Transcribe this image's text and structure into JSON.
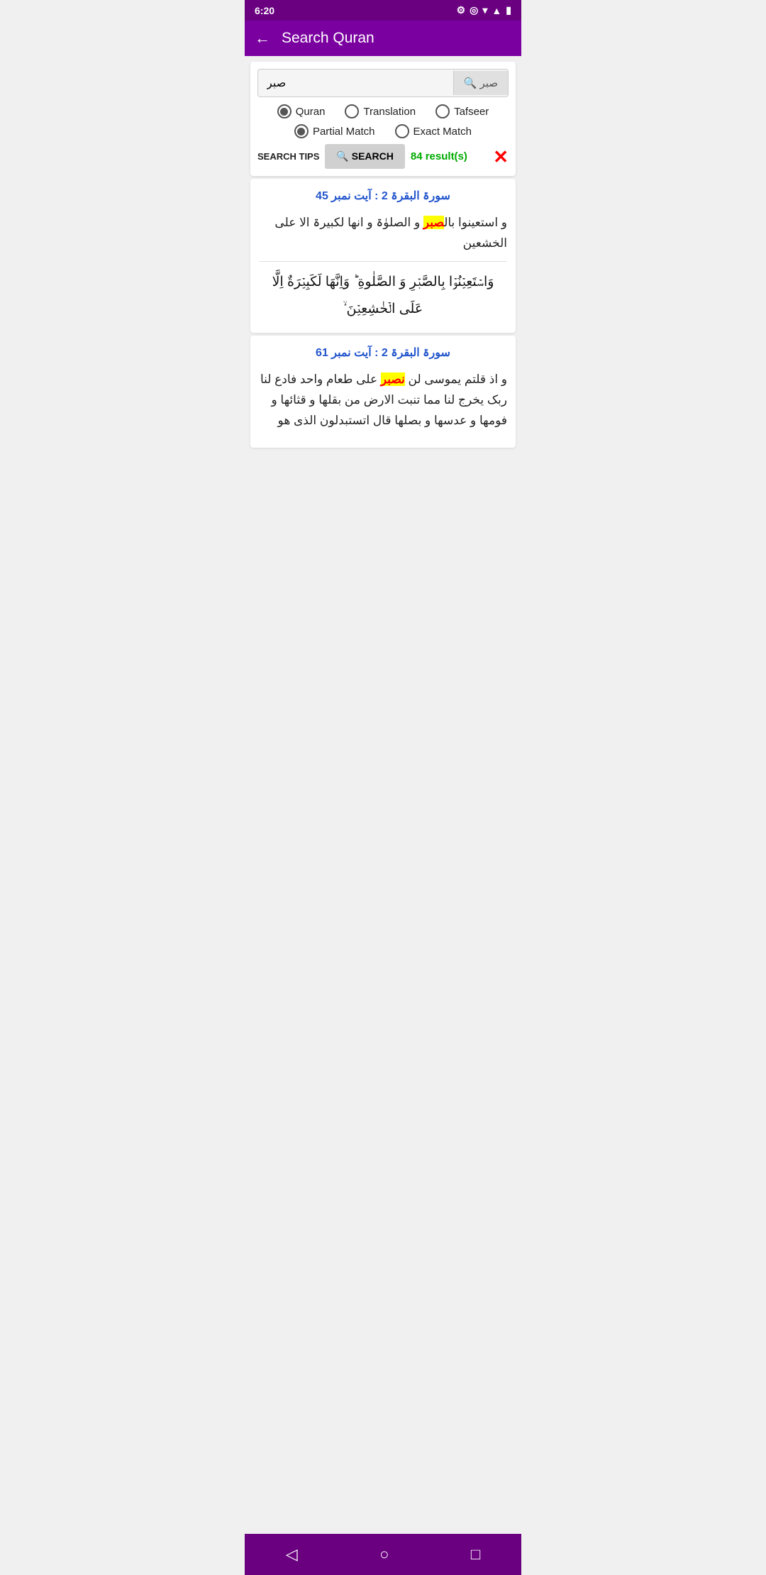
{
  "statusBar": {
    "time": "6:20",
    "icons": [
      "settings",
      "circle-badge",
      "wifi",
      "signal",
      "battery"
    ]
  },
  "topBar": {
    "title": "Search Quran",
    "backLabel": "←"
  },
  "searchInput": {
    "value": "صبر",
    "placeholder": ""
  },
  "radioGroups": {
    "source": [
      {
        "id": "quran",
        "label": "Quran",
        "selected": true
      },
      {
        "id": "translation",
        "label": "Translation",
        "selected": false
      },
      {
        "id": "tafseer",
        "label": "Tafseer",
        "selected": false
      }
    ],
    "matchType": [
      {
        "id": "partial",
        "label": "Partial Match",
        "selected": true
      },
      {
        "id": "exact",
        "label": "Exact Match",
        "selected": false
      }
    ]
  },
  "actions": {
    "searchTipsLabel": "SEARCH TIPS",
    "searchBtnLabel": "🔍 SEARCH",
    "resultCount": "84 result(s)",
    "clearLabel": "✕"
  },
  "results": [
    {
      "header": "سورۃ البقرۃ 2 : آیت نمبر 45",
      "translation": "و استعینوا بالصبر و الصلوٰۃ و انھا لکبیرۃ الا علی الخشعین",
      "highlightWord": "صبر",
      "arabic": "وَاسۡتَعِيۡنُوۡا بِالصَّبۡرِ وَ الصَّلٰوةِ ؕ وَاِنَّهَا لَكَبِيۡرَةٌ اِلَّا عَلَى الۡخٰشِعِيۡنَ ۙ‏"
    },
    {
      "header": "سورۃ البقرۃ 2 : آیت نمبر 61",
      "translation": "و اذ قلتم یموسی لن نصبر علی طعام واحد فادع لنا ربک یخرج لنا مما تنبت الارض من بقلھا و قثائھا و فومھا و عدسھا و بصلھا قال اتستبدلون الذی ھو",
      "highlightWord": "نصبر",
      "arabic": ""
    }
  ],
  "bottomNav": {
    "back": "◁",
    "home": "○",
    "recent": "□"
  }
}
